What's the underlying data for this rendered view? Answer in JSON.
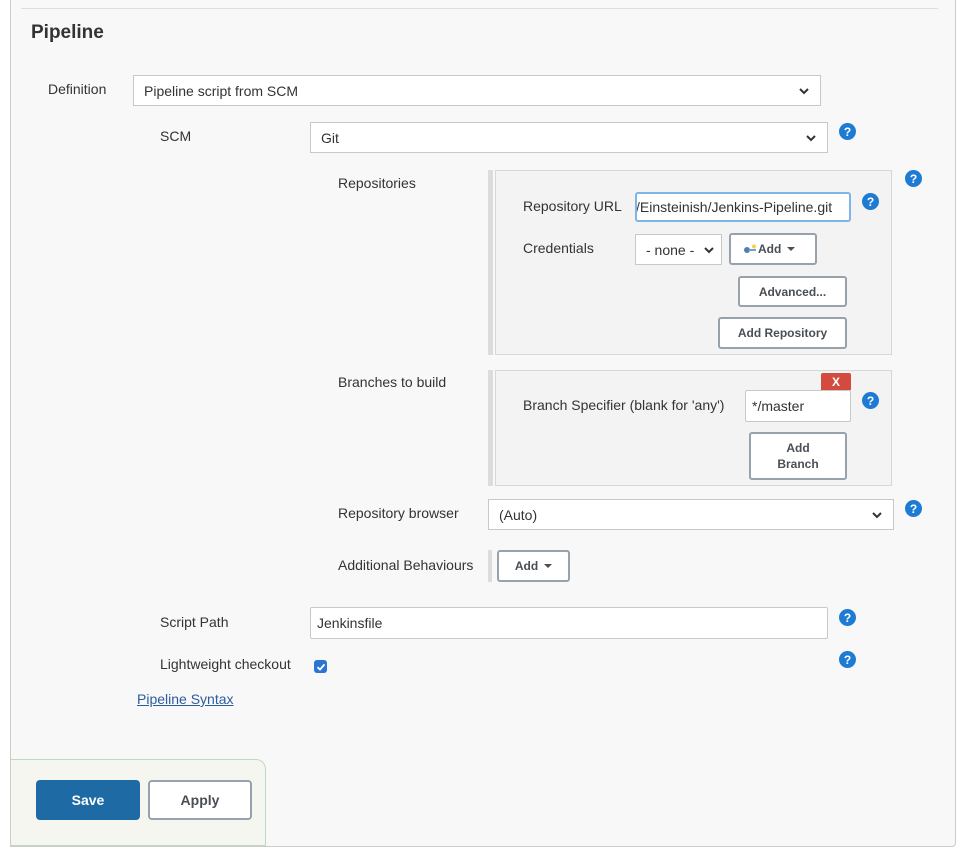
{
  "section": {
    "title": "Pipeline"
  },
  "definition": {
    "label": "Definition",
    "selected": "Pipeline script from SCM"
  },
  "scm": {
    "label": "SCM",
    "selected": "Git"
  },
  "repositories": {
    "label": "Repositories",
    "repository_url_label": "Repository URL",
    "repository_url_value": "/Einsteinish/Jenkins-Pipeline.git",
    "credentials_label": "Credentials",
    "credentials_selected": "- none -",
    "credentials_add_label": "Add",
    "advanced_label": "Advanced...",
    "add_repository_label": "Add Repository"
  },
  "branches": {
    "label": "Branches to build",
    "delete_label": "X",
    "branch_specifier_label": "Branch Specifier (blank for 'any')",
    "branch_specifier_value": "*/master",
    "add_branch_label": "Add Branch"
  },
  "repository_browser": {
    "label": "Repository browser",
    "selected": "(Auto)"
  },
  "additional_behaviours": {
    "label": "Additional Behaviours",
    "add_label": "Add"
  },
  "script_path": {
    "label": "Script Path",
    "value": "Jenkinsfile"
  },
  "lightweight_checkout": {
    "label": "Lightweight checkout",
    "checked": true
  },
  "pipeline_syntax_link": "Pipeline Syntax",
  "footer": {
    "save_label": "Save",
    "apply_label": "Apply"
  },
  "help_icon_glyph": "?",
  "colors": {
    "accent": "#1d6aa5",
    "help": "#1e7bd4",
    "delete": "#d24b3e",
    "link": "#2d5c9e"
  }
}
